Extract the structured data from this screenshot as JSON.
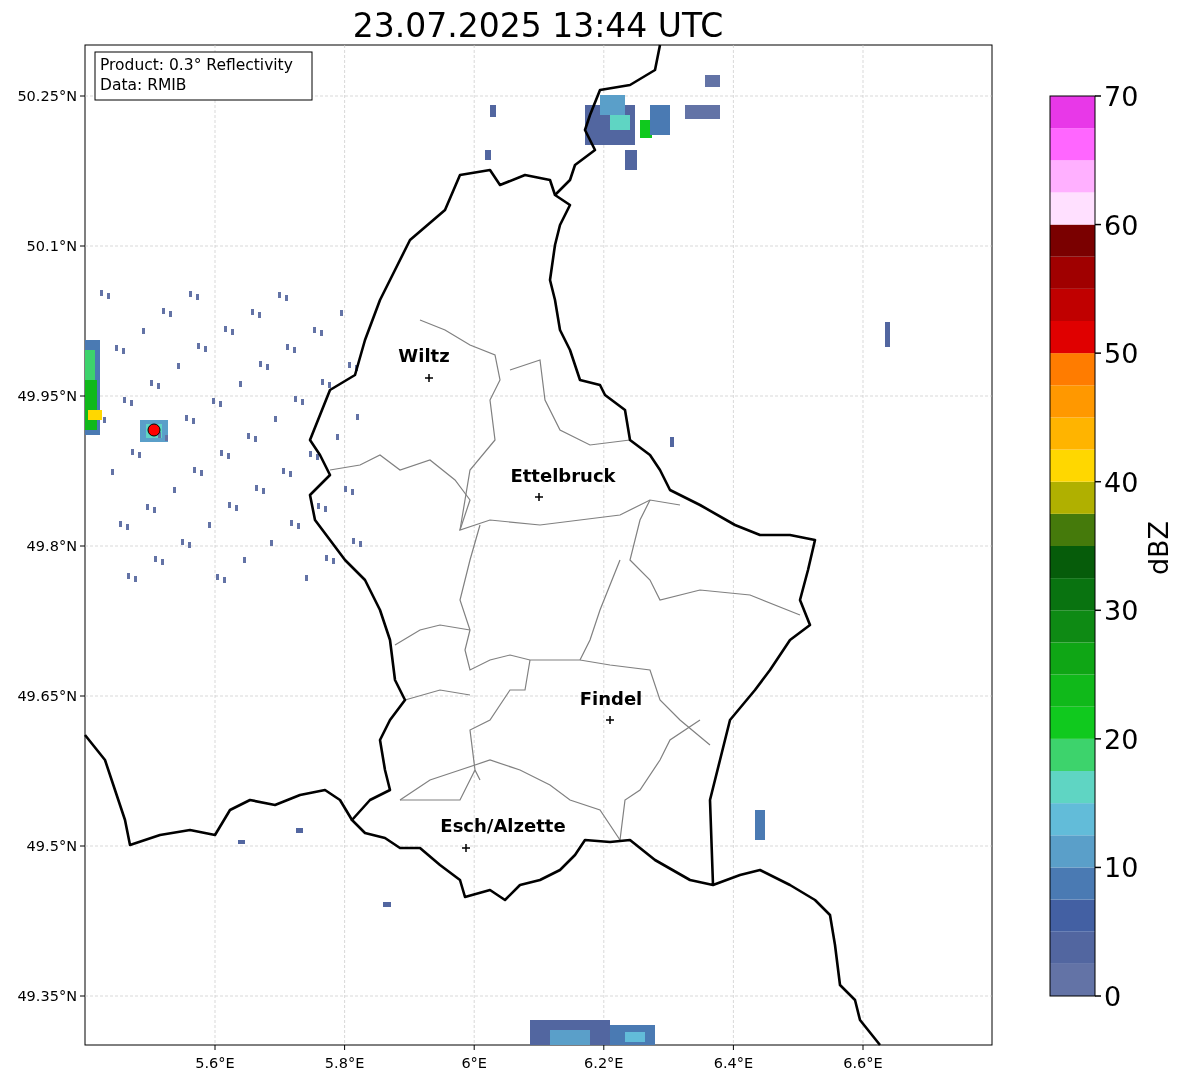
{
  "title": "23.07.2025 13:44 UTC",
  "info_box": {
    "lines": [
      "Product: 0.3° Reflectivity",
      "Data: RMIB"
    ]
  },
  "axes": {
    "yticks": [
      "50.25°N",
      "50.1°N",
      "49.95°N",
      "49.8°N",
      "49.65°N",
      "49.5°N",
      "49.35°N"
    ],
    "xticks": [
      "5.6°E",
      "5.8°E",
      "6°E",
      "6.2°E",
      "6.4°E",
      "6.6°E"
    ]
  },
  "cities": [
    {
      "name": "Wiltz"
    },
    {
      "name": "Ettelbruck"
    },
    {
      "name": "Findel"
    },
    {
      "name": "Esch/Alzette"
    }
  ],
  "colorbar": {
    "label": "dBZ",
    "ticks": [
      "70",
      "60",
      "50",
      "40",
      "30",
      "20",
      "10",
      "0"
    ],
    "bands": [
      {
        "color": "#6373a6"
      },
      {
        "color": "#5266a0"
      },
      {
        "color": "#4360a3"
      },
      {
        "color": "#4a7ab3"
      },
      {
        "color": "#5a9fc9"
      },
      {
        "color": "#62bcd9"
      },
      {
        "color": "#5fd5c3"
      },
      {
        "color": "#3dd36c"
      },
      {
        "color": "#10c91e"
      },
      {
        "color": "#10b91a"
      },
      {
        "color": "#0fa615"
      },
      {
        "color": "#0e8a14"
      },
      {
        "color": "#097310"
      },
      {
        "color": "#065c0a"
      },
      {
        "color": "#457a0b"
      },
      {
        "color": "#b0b000"
      },
      {
        "color": "#ffd700"
      },
      {
        "color": "#ffb400"
      },
      {
        "color": "#ff9800"
      },
      {
        "color": "#ff7c00"
      },
      {
        "color": "#e00000"
      },
      {
        "color": "#c00000"
      },
      {
        "color": "#a00000"
      },
      {
        "color": "#7a0000"
      },
      {
        "color": "#ffe0ff"
      },
      {
        "color": "#ffb0ff"
      },
      {
        "color": "#ff66ff"
      },
      {
        "color": "#e838e8"
      }
    ]
  }
}
